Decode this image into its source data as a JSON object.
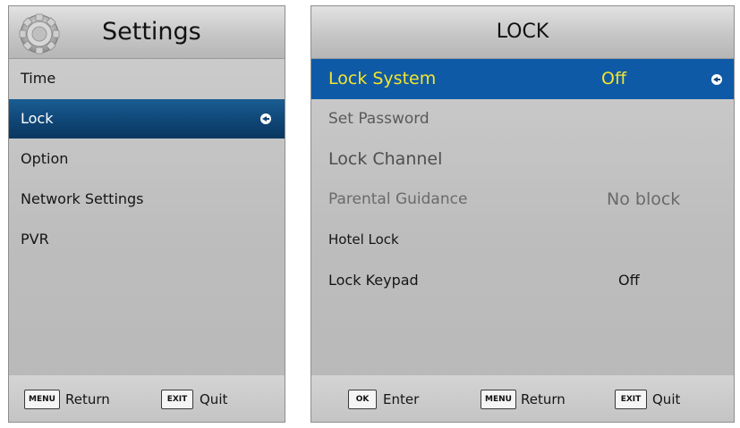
{
  "settings_menu": {
    "title": "Settings",
    "items": [
      {
        "label": "Time"
      },
      {
        "label": "Lock"
      },
      {
        "label": "Option"
      },
      {
        "label": "Network Settings"
      },
      {
        "label": "PVR"
      }
    ],
    "footer": {
      "return_key": "MENU",
      "return_label": "Return",
      "quit_key": "EXIT",
      "quit_label": "Quit"
    }
  },
  "lock_menu": {
    "title": "LOCK",
    "rows": [
      {
        "label": "Lock System",
        "value": "Off"
      },
      {
        "label": "Set Password",
        "value": ""
      },
      {
        "label": "Lock Channel",
        "value": ""
      },
      {
        "label": "Parental Guidance",
        "value": "No block"
      },
      {
        "label": "Hotel Lock",
        "value": ""
      },
      {
        "label": "Lock Keypad",
        "value": "Off"
      }
    ],
    "footer": {
      "enter_key": "OK",
      "enter_label": "Enter",
      "return_key": "MENU",
      "return_label": "Return",
      "quit_key": "EXIT",
      "quit_label": "Quit"
    }
  },
  "colors": {
    "highlight_blue": "#0f5aa6",
    "selected_text_yellow": "#f4e52c",
    "panel_gray": "#bdbdbd"
  },
  "icons": [
    "gear-icon",
    "select-arrow-icon"
  ]
}
